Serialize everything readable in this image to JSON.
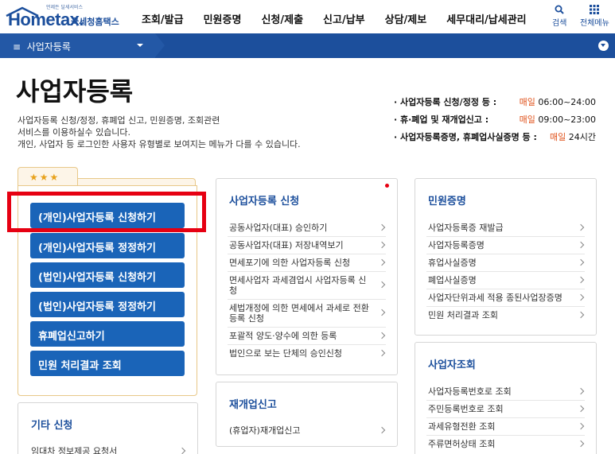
{
  "header": {
    "logo_slogan": "언제든 달세서비스",
    "logo_text": "Hometax.",
    "logo_sub": "국세청홈택스",
    "nav": [
      "조회/발급",
      "민원증명",
      "신청/제출",
      "신고/납부",
      "상담/제보",
      "세무대리/납세관리"
    ],
    "search_label": "검색",
    "allmenu_label": "전체메뉴"
  },
  "locbar": {
    "current": "사업자등록"
  },
  "title": {
    "heading": "사업자등록",
    "desc_line1": "사업자등록 신청/정정, 휴폐업 신고, 민원증명, 조회관련",
    "desc_line2": "서비스를 이용하실수 있습니다.",
    "desc_line3": "개인, 사업자 등 로그인한 사용자 유형별로 보여지는 메뉴가 다를 수 있습니다."
  },
  "hours": [
    {
      "label": "· 사업자등록 신청/정정 등 :",
      "prefix": "매일",
      "time": " 06:00~24:00"
    },
    {
      "label": "· 휴·폐업 및 재개업신고 :",
      "prefix": "매일",
      "time": " 09:00~23:00"
    },
    {
      "label": "· 사업자등록증명, 휴폐업사실증명 등 :",
      "prefix": "매일",
      "time": " 24시간"
    }
  ],
  "favorites": {
    "stars": "★★★",
    "buttons": [
      "(개인)사업자등록 신청하기",
      "(개인)사업자등록 정정하기",
      "(법인)사업자등록 신청하기",
      "(법인)사업자등록 정정하기",
      "휴폐업신고하기",
      "민원 처리결과 조회"
    ]
  },
  "card_register": {
    "title": "사업자등록 신청",
    "items": [
      "공동사업자(대표) 승인하기",
      "공동사업자(대표) 저장내역보기",
      "면세포기에 의한 사업자등록 신청",
      "면세사업자 과세겸업시 사업자등록 신청",
      "세법개정에 의한 면세에서 과세로 전환 등록 신청",
      "포괄적 양도·양수에 의한 등록",
      "법인으로 보는 단체의 승인신청"
    ]
  },
  "card_cert": {
    "title": "민원증명",
    "items": [
      "사업자등록증 재발급",
      "사업자등록증명",
      "휴업사실증명",
      "폐업사실증명",
      "사업자단위과세 적용 종된사업장증명",
      "민원 처리결과 조회"
    ]
  },
  "card_reopen": {
    "title": "재개업신고",
    "items": [
      "(휴업자)재개업신고"
    ]
  },
  "card_lookup": {
    "title": "사업자조회",
    "items": [
      "사업자등록번호로 조회",
      "주민등록번호로 조회",
      "과세유형전환 조회",
      "주류면허상태 조회"
    ]
  },
  "card_other": {
    "title": "기타 신청",
    "items": [
      "임대차 정보제공 요청서"
    ]
  },
  "colors": {
    "brand": "#1c4f9c",
    "button": "#1a64b8",
    "highlight": "#e60012",
    "accent_time": "#e0531c"
  }
}
